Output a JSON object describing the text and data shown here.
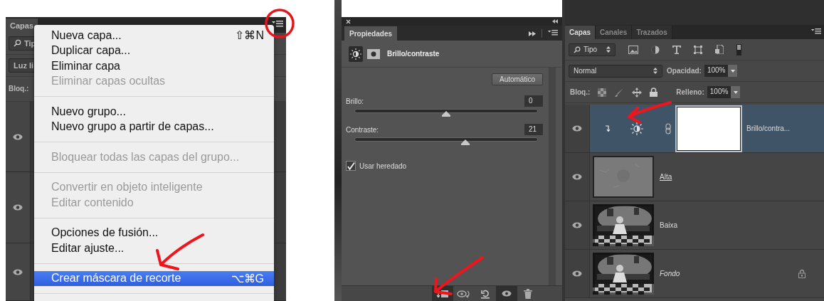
{
  "left_panel": {
    "tabs": [
      {
        "label": "Capas",
        "selected": true
      }
    ],
    "search": {
      "value": "Tip"
    },
    "blend_mode": {
      "value": "Luz li"
    },
    "lock_label": "Bloq.:",
    "layers": [
      {
        "visible": true
      },
      {
        "visible": true
      },
      {
        "visible": true
      }
    ]
  },
  "context_menu": {
    "groups": [
      [
        {
          "label": "Nueva capa...",
          "shortcut": "⇧⌘N",
          "disabled": false,
          "selected": false
        },
        {
          "label": "Duplicar capa...",
          "disabled": false,
          "selected": false
        },
        {
          "label": "Eliminar capa",
          "disabled": false,
          "selected": false
        },
        {
          "label": "Eliminar capas ocultas",
          "disabled": true,
          "selected": false
        }
      ],
      [
        {
          "label": "Nuevo grupo...",
          "disabled": false,
          "selected": false
        },
        {
          "label": "Nuevo grupo a partir de capas...",
          "disabled": false,
          "selected": false
        }
      ],
      [
        {
          "label": "Bloquear todas las capas del grupo...",
          "disabled": true,
          "selected": false
        }
      ],
      [
        {
          "label": "Convertir en objeto inteligente",
          "disabled": true,
          "selected": false
        },
        {
          "label": "Editar contenido",
          "disabled": true,
          "selected": false
        }
      ],
      [
        {
          "label": "Opciones de fusión...",
          "disabled": false,
          "selected": false
        },
        {
          "label": "Editar ajuste...",
          "disabled": false,
          "selected": false
        }
      ],
      [
        {
          "label": "Crear máscara de recorte",
          "shortcut": "⌥⌘G",
          "disabled": false,
          "selected": true
        }
      ]
    ]
  },
  "properties_panel": {
    "tabs": [
      {
        "label": "Propiedades",
        "selected": true
      }
    ],
    "title": "Brillo/contraste",
    "auto_button": "Automático",
    "sliders": [
      {
        "label": "Brillo:",
        "value": "0",
        "level": 0.5
      },
      {
        "label": "Contraste:",
        "value": "21",
        "level": 0.605
      }
    ],
    "use_legacy": {
      "label": "Usar heredado",
      "checked": true
    }
  },
  "layers_panel": {
    "tabs": [
      {
        "label": "Capas",
        "selected": true
      },
      {
        "label": "Canales",
        "selected": false
      },
      {
        "label": "Trazados",
        "selected": false
      }
    ],
    "filter": {
      "value": "Tipo"
    },
    "blend_mode": {
      "value": "Normal"
    },
    "opacity": {
      "label": "Opacidad:",
      "value": "100%"
    },
    "lock_label": "Bloq.:",
    "fill": {
      "label": "Relleno:",
      "value": "100%"
    },
    "layers": [
      {
        "name": "Brillo/contra...",
        "kind": "adjustment",
        "visible": true,
        "selected": true,
        "clipped": true,
        "locked": false,
        "underlined": false
      },
      {
        "name": "Alta",
        "kind": "pixel",
        "visible": true,
        "selected": false,
        "clipped": false,
        "locked": false,
        "underlined": true
      },
      {
        "name": "Baixa",
        "kind": "pixel",
        "visible": true,
        "selected": false,
        "clipped": false,
        "locked": false,
        "underlined": false
      },
      {
        "name": "Fondo",
        "kind": "pixel",
        "visible": true,
        "selected": false,
        "clipped": false,
        "locked": true,
        "underlined": false
      }
    ]
  }
}
